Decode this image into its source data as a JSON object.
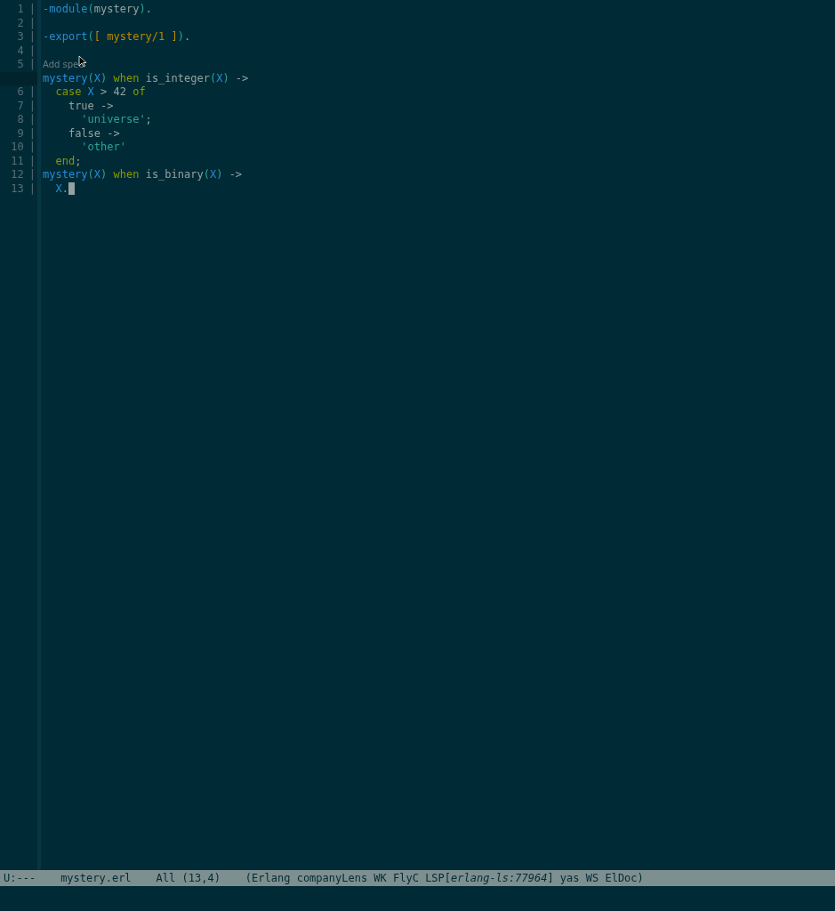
{
  "editor": {
    "lines": [
      {
        "number": "1",
        "separator": "|",
        "tokens": [
          {
            "text": "-module",
            "kind": "directive"
          },
          {
            "text": "(",
            "kind": "paren"
          },
          {
            "text": "mystery",
            "kind": "plain"
          },
          {
            "text": ")",
            "kind": "paren"
          },
          {
            "text": ".",
            "kind": "plain"
          }
        ]
      },
      {
        "number": "2",
        "separator": "|"
      },
      {
        "number": "3",
        "separator": "|",
        "tokens": [
          {
            "text": "-export",
            "kind": "directive"
          },
          {
            "text": "(",
            "kind": "paren"
          },
          {
            "text": "[ mystery/1 ]",
            "kind": "constant"
          },
          {
            "text": ")",
            "kind": "paren"
          },
          {
            "text": ".",
            "kind": "plain"
          }
        ]
      },
      {
        "number": "4",
        "separator": "|"
      },
      {
        "number": "5",
        "separator": "|",
        "lens": "Add spec",
        "tokens": [
          {
            "text": "mystery",
            "kind": "function"
          },
          {
            "text": "(",
            "kind": "paren"
          },
          {
            "text": "X",
            "kind": "variable"
          },
          {
            "text": ")",
            "kind": "paren"
          },
          {
            "text": " when",
            "kind": "keyword"
          },
          {
            "text": " is_integer",
            "kind": "plain"
          },
          {
            "text": "(",
            "kind": "paren"
          },
          {
            "text": "X",
            "kind": "variable"
          },
          {
            "text": ")",
            "kind": "paren"
          },
          {
            "text": " ->",
            "kind": "plain"
          }
        ]
      },
      {
        "number": "6",
        "separator": "|",
        "tokens": [
          {
            "text": "  case",
            "kind": "keyword"
          },
          {
            "text": " X",
            "kind": "variable"
          },
          {
            "text": " > 42",
            "kind": "plain"
          },
          {
            "text": " of",
            "kind": "keyword"
          }
        ]
      },
      {
        "number": "7",
        "separator": "|",
        "tokens": [
          {
            "text": "    true ->",
            "kind": "plain"
          }
        ]
      },
      {
        "number": "8",
        "separator": "|",
        "tokens": [
          {
            "text": "      'universe'",
            "kind": "atom"
          },
          {
            "text": ";",
            "kind": "plain"
          }
        ]
      },
      {
        "number": "9",
        "separator": "|",
        "tokens": [
          {
            "text": "    false ->",
            "kind": "plain"
          }
        ]
      },
      {
        "number": "10",
        "separator": "|",
        "tokens": [
          {
            "text": "      'other'",
            "kind": "atom"
          }
        ]
      },
      {
        "number": "11",
        "separator": "|",
        "tokens": [
          {
            "text": "  end",
            "kind": "keyword"
          },
          {
            "text": ";",
            "kind": "plain"
          }
        ]
      },
      {
        "number": "12",
        "separator": "|",
        "tokens": [
          {
            "text": "mystery",
            "kind": "function"
          },
          {
            "text": "(",
            "kind": "paren"
          },
          {
            "text": "X",
            "kind": "variable"
          },
          {
            "text": ")",
            "kind": "paren"
          },
          {
            "text": " when",
            "kind": "keyword"
          },
          {
            "text": " is_binary",
            "kind": "plain"
          },
          {
            "text": "(",
            "kind": "paren"
          },
          {
            "text": "X",
            "kind": "variable"
          },
          {
            "text": ")",
            "kind": "paren"
          },
          {
            "text": " ->",
            "kind": "plain"
          }
        ]
      },
      {
        "number": "13",
        "separator": "|",
        "cursor": true,
        "tokens": [
          {
            "text": "  X",
            "kind": "variable"
          },
          {
            "text": ".",
            "kind": "plain"
          }
        ]
      }
    ]
  },
  "mode_line": {
    "segments": [
      "U:---",
      "mystery.erl",
      "All (13,4)",
      "(Erlang companyLens WK FlyC LSP[*erlang-ls:77964*] yas WS ElDoc)"
    ]
  }
}
